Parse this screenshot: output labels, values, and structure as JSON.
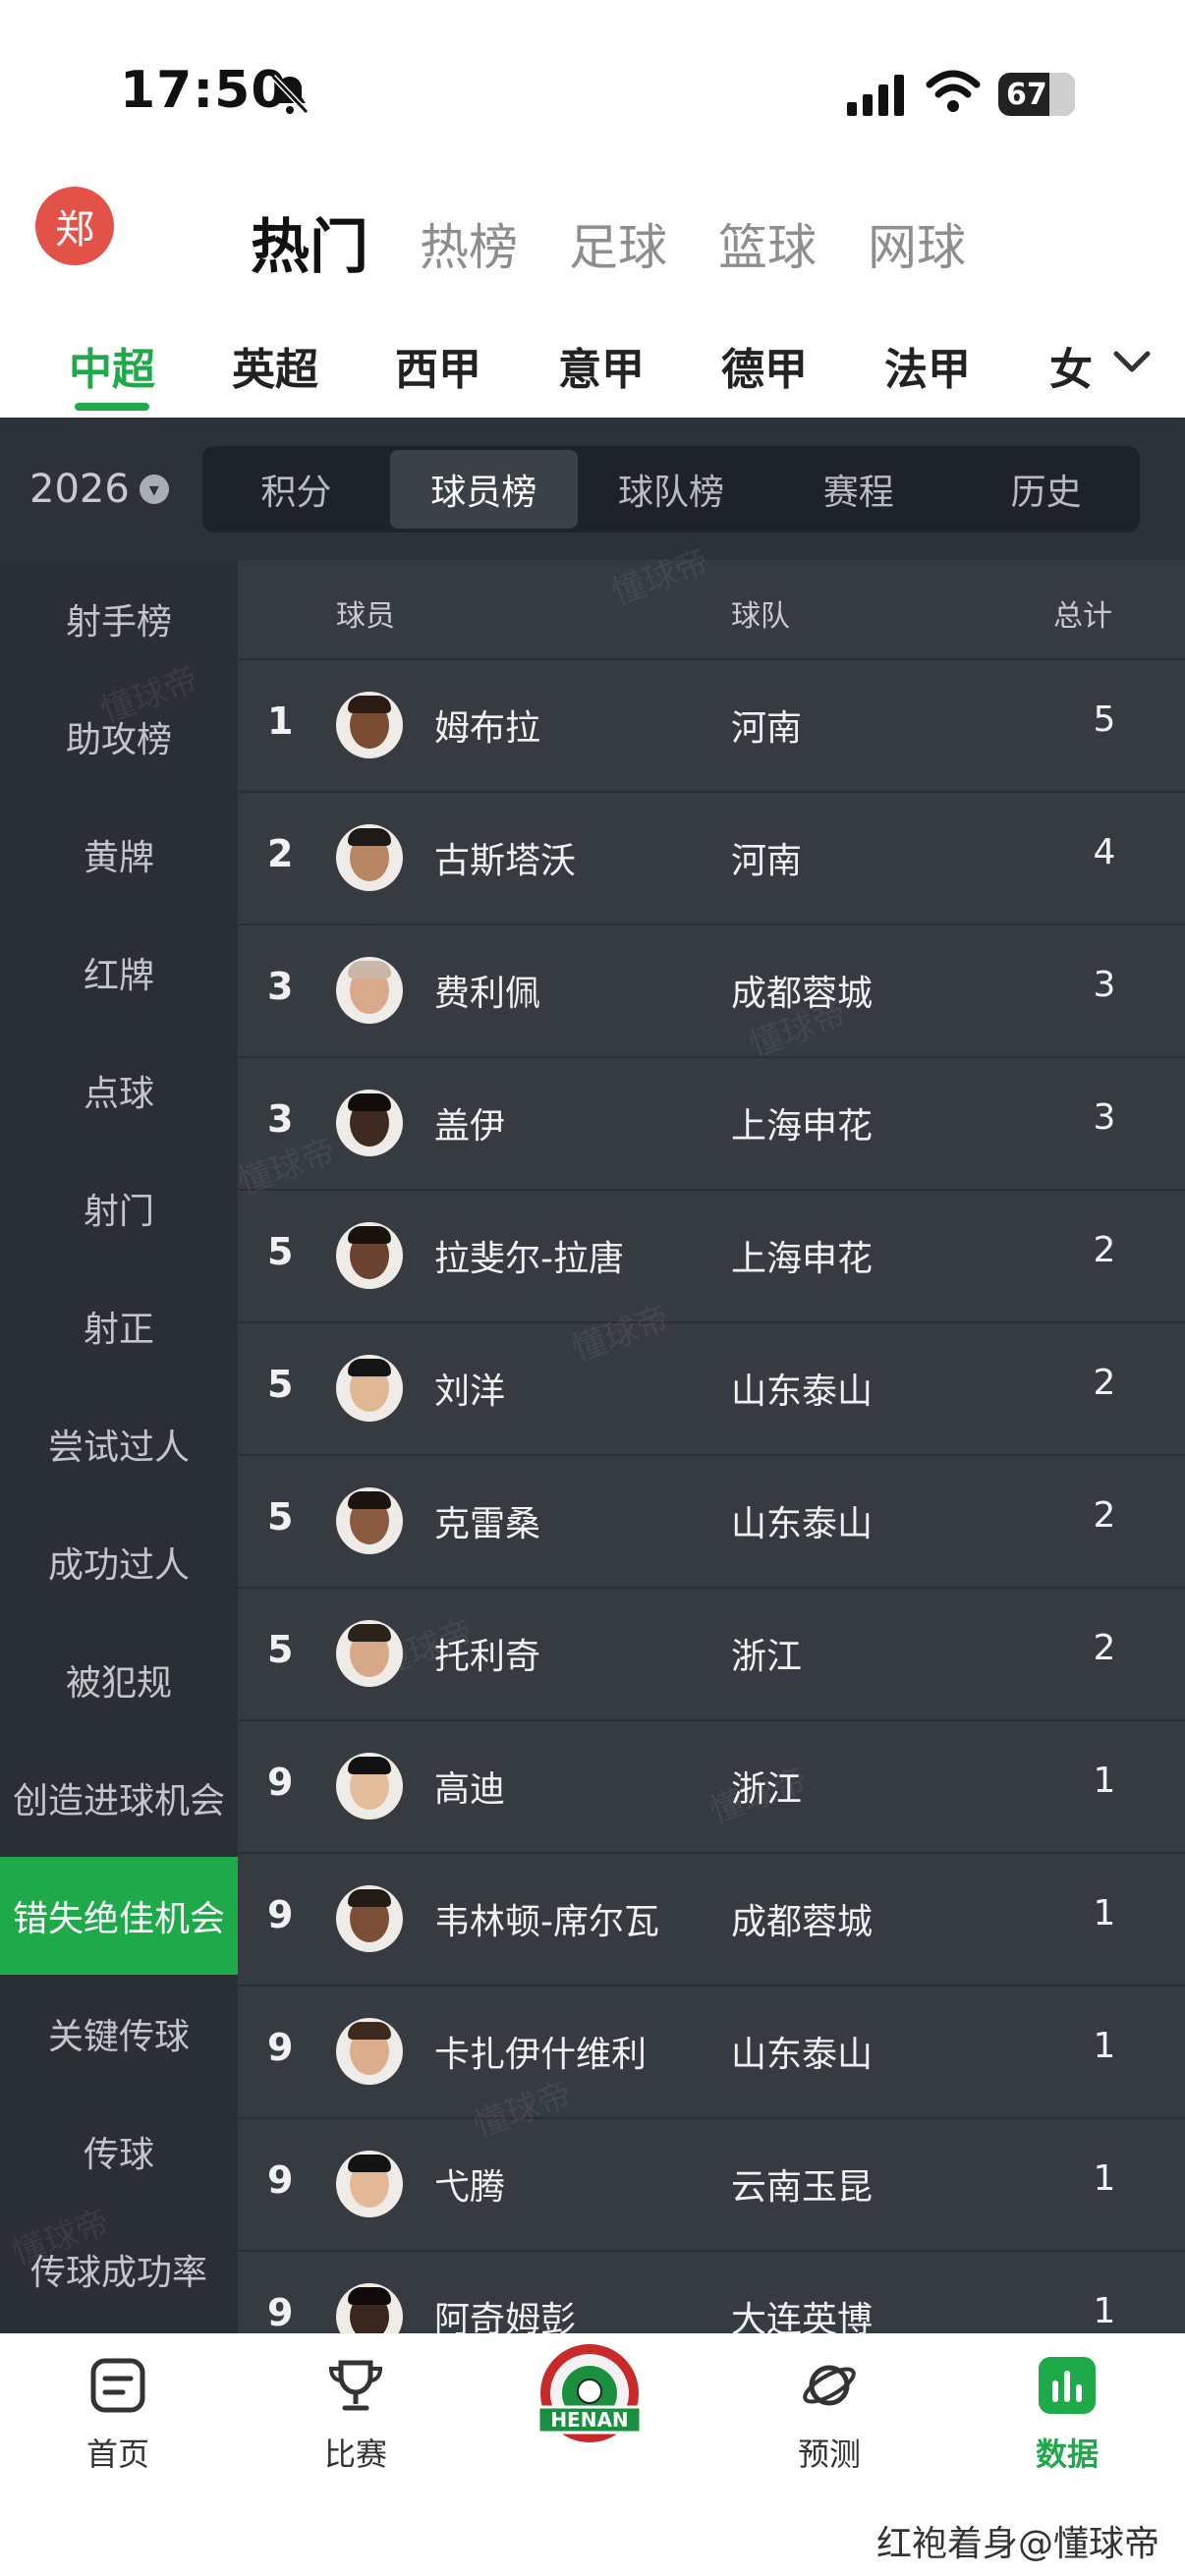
{
  "status": {
    "time": "17:50",
    "battery": "67"
  },
  "header": {
    "avatar_text": "郑",
    "top_tabs": [
      "热门",
      "热榜",
      "足球",
      "篮球",
      "网球"
    ],
    "league_tabs": [
      "中超",
      "英超",
      "西甲",
      "意甲",
      "德甲",
      "法甲",
      "女"
    ]
  },
  "season": "2026",
  "segment_tabs": [
    "积分",
    "球员榜",
    "球队榜",
    "赛程",
    "历史"
  ],
  "sidebar": {
    "items": [
      "射手榜",
      "助攻榜",
      "黄牌",
      "红牌",
      "点球",
      "射门",
      "射正",
      "尝试过人",
      "成功过人",
      "被犯规",
      "创造进球机会",
      "错失绝佳机会",
      "关键传球",
      "传球",
      "传球成功率"
    ]
  },
  "table": {
    "columns": {
      "player": "球员",
      "team": "球队",
      "total": "总计"
    },
    "rows": [
      {
        "rank": "1",
        "name": "姆布拉",
        "team": "河南",
        "total": "5"
      },
      {
        "rank": "2",
        "name": "古斯塔沃",
        "team": "河南",
        "total": "4"
      },
      {
        "rank": "3",
        "name": "费利佩",
        "team": "成都蓉城",
        "total": "3"
      },
      {
        "rank": "3",
        "name": "盖伊",
        "team": "上海申花",
        "total": "3"
      },
      {
        "rank": "5",
        "name": "拉斐尔-拉唐",
        "team": "上海申花",
        "total": "2"
      },
      {
        "rank": "5",
        "name": "刘洋",
        "team": "山东泰山",
        "total": "2"
      },
      {
        "rank": "5",
        "name": "克雷桑",
        "team": "山东泰山",
        "total": "2"
      },
      {
        "rank": "5",
        "name": "托利奇",
        "team": "浙江",
        "total": "2"
      },
      {
        "rank": "9",
        "name": "高迪",
        "team": "浙江",
        "total": "1"
      },
      {
        "rank": "9",
        "name": "韦林顿-席尔瓦",
        "team": "成都蓉城",
        "total": "1"
      },
      {
        "rank": "9",
        "name": "卡扎伊什维利",
        "team": "山东泰山",
        "total": "1"
      },
      {
        "rank": "9",
        "name": "弋腾",
        "team": "云南玉昆",
        "total": "1"
      },
      {
        "rank": "9",
        "name": "阿奇姆彭",
        "team": "大连英博",
        "total": "1"
      }
    ]
  },
  "bottom_nav": [
    "首页",
    "比赛",
    "预测",
    "数据"
  ],
  "badge_text": "HENAN",
  "watermark_text": "懂球帝",
  "footer_note": "红袍着身@懂球帝",
  "colors": {
    "accent": "#1ea94b",
    "dark_bg": "#2c3237",
    "avatar": "#e35249"
  }
}
